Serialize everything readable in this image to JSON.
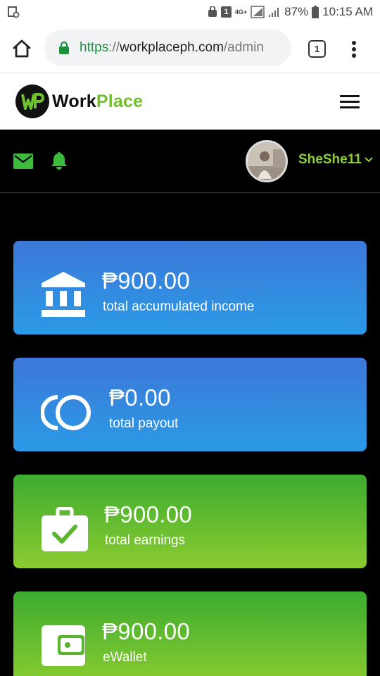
{
  "status_bar": {
    "battery": "87%",
    "time": "10:15 AM",
    "network": "4G+",
    "sim_badge": "1"
  },
  "browser": {
    "url_scheme": "https",
    "url_sep": "://",
    "url_host": "workplaceph.com",
    "url_path": "/admin",
    "tab_count": "1"
  },
  "site": {
    "logo_work": "Work",
    "logo_place": "Place",
    "brand_color": "#6fc02c"
  },
  "topbar": {
    "username": "SheShe11"
  },
  "cards": [
    {
      "amount": "₱900.00",
      "label": "total accumulated income",
      "icon": "bank-icon",
      "color": "blue"
    },
    {
      "amount": "₱0.00",
      "label": "total payout",
      "icon": "coins-icon",
      "color": "blue"
    },
    {
      "amount": "₱900.00",
      "label": "total earnings",
      "icon": "briefcase-check-icon",
      "color": "green"
    },
    {
      "amount": "₱900.00",
      "label": "eWallet",
      "icon": "wallet-icon",
      "color": "green"
    }
  ]
}
